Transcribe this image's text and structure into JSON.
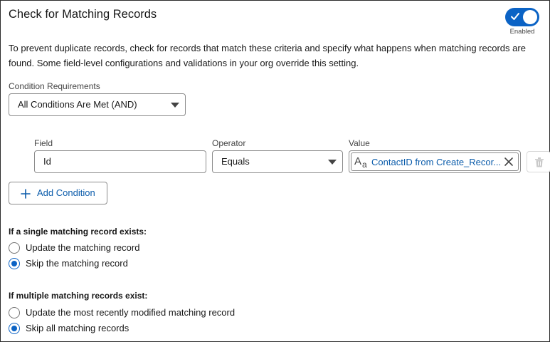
{
  "header": {
    "title": "Check for Matching Records",
    "toggle_state_label": "Enabled",
    "toggle_on": true
  },
  "description": "To prevent duplicate records, check for records that match these criteria and specify what happens when matching records are found. Some field-level configurations and validations in your org override this setting.",
  "condition_requirements": {
    "label": "Condition Requirements",
    "selected": "All Conditions Are Met (AND)"
  },
  "condition_row": {
    "field_label": "Field",
    "field_value": "Id",
    "operator_label": "Operator",
    "operator_value": "Equals",
    "value_label": "Value",
    "value_pill_text": "ContactID from Create_Recor..."
  },
  "add_condition_label": "Add Condition",
  "single_match": {
    "heading": "If a single matching record exists:",
    "options": [
      {
        "label": "Update the matching record",
        "selected": false
      },
      {
        "label": "Skip the matching record",
        "selected": true
      }
    ]
  },
  "multiple_match": {
    "heading": "If multiple matching records exist:",
    "options": [
      {
        "label": "Update the most recently modified matching record",
        "selected": false
      },
      {
        "label": "Skip all matching records",
        "selected": true
      }
    ]
  },
  "colors": {
    "brand_blue": "#0b63c5",
    "link_blue": "#0b5cab"
  },
  "icons": {
    "toggle": "check-icon",
    "pill": "text-aa-icon",
    "pill_remove": "close-icon",
    "delete": "trash-icon",
    "add": "plus-icon"
  }
}
